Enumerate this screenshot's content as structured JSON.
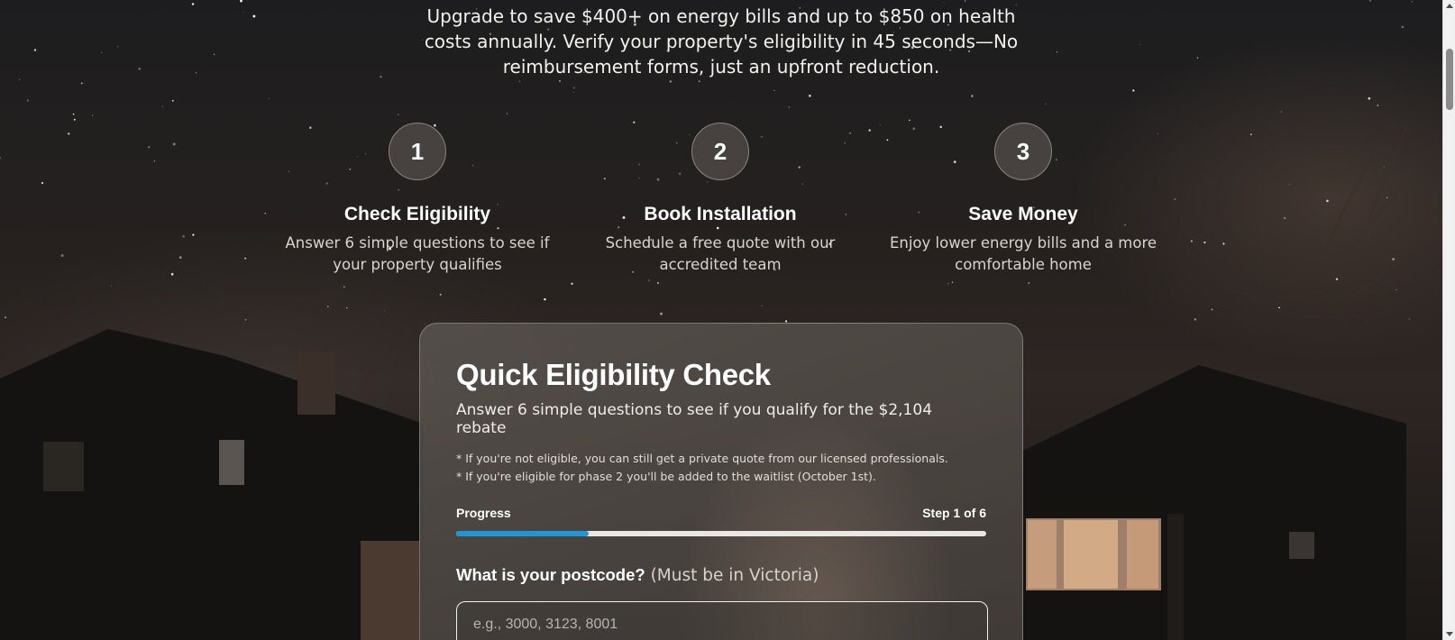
{
  "hero": {
    "description": "Upgrade to save $400+ on energy bills and up to $850 on health costs annually. Verify your property's eligibility in 45 seconds—No reimbursement forms, just an upfront reduction."
  },
  "steps": [
    {
      "number": "1",
      "title": "Check Eligibility",
      "description": "Answer 6 simple questions to see if your property qualifies"
    },
    {
      "number": "2",
      "title": "Book Installation",
      "description": "Schedule a free quote with our accredited team"
    },
    {
      "number": "3",
      "title": "Save Money",
      "description": "Enjoy lower energy bills and a more comfortable home"
    }
  ],
  "card": {
    "title": "Quick Eligibility Check",
    "subtitle": "Answer 6 simple questions to see if you qualify for the $2,104 rebate",
    "notes": [
      "* If you're not eligible, you can still get a private quote from our licensed professionals.",
      "* If you're eligible for phase 2 you'll be added to the waitlist (October 1st)."
    ],
    "progress_label": "Progress",
    "step_label": "Step 1 of 6",
    "progress_fraction": 0.25,
    "question": "What is your postcode?",
    "question_hint": "(Must be in Victoria)",
    "postcode_placeholder": "e.g., 3000, 3123, 8001",
    "postcode_value": ""
  },
  "colors": {
    "accent": "#2196d6"
  }
}
